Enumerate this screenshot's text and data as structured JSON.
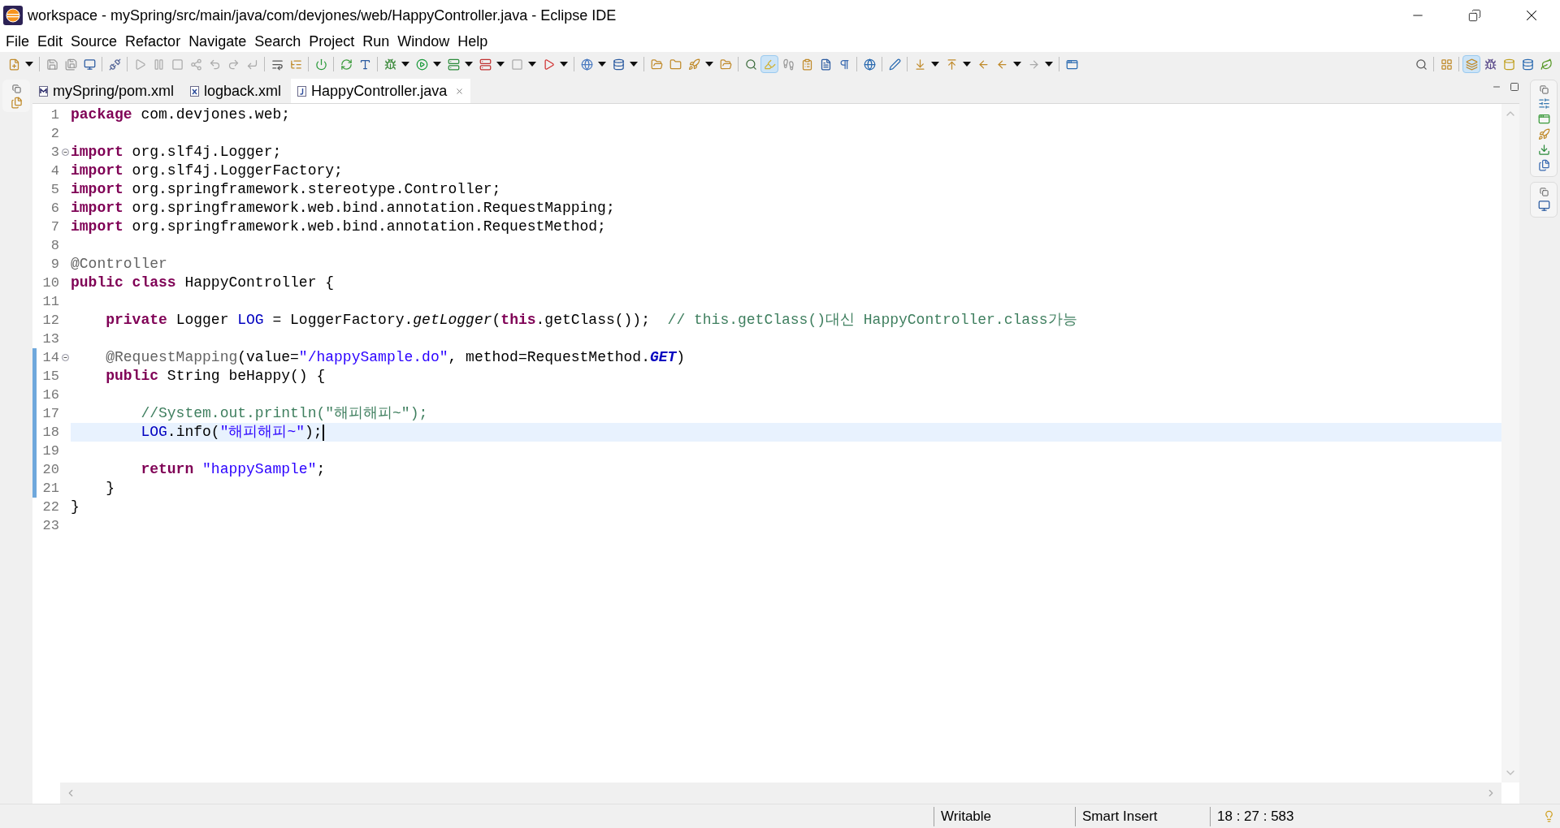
{
  "window": {
    "title": "workspace - mySpring/src/main/java/com/devjones/web/HappyController.java - Eclipse IDE"
  },
  "menu": [
    "File",
    "Edit",
    "Source",
    "Refactor",
    "Navigate",
    "Search",
    "Project",
    "Run",
    "Window",
    "Help"
  ],
  "tabs": [
    {
      "label": "mySpring/pom.xml",
      "kind": "maven",
      "selected": false
    },
    {
      "label": "logback.xml",
      "kind": "xml",
      "selected": false
    },
    {
      "label": "HappyController.java",
      "kind": "java",
      "selected": true
    }
  ],
  "editor": {
    "lines": [
      {
        "number": "1",
        "tokens": [
          {
            "kind": "keyword",
            "text": "package"
          },
          {
            "kind": "plain",
            "text": " com.devjones.web;"
          }
        ]
      },
      {
        "number": "2"
      },
      {
        "number": "3",
        "foldable": true,
        "tokens": [
          {
            "kind": "keyword",
            "text": "import"
          },
          {
            "kind": "plain",
            "text": " org.slf4j.Logger;"
          }
        ]
      },
      {
        "number": "4",
        "tokens": [
          {
            "kind": "keyword",
            "text": "import"
          },
          {
            "kind": "plain",
            "text": " org.slf4j.LoggerFactory;"
          }
        ]
      },
      {
        "number": "5",
        "tokens": [
          {
            "kind": "keyword",
            "text": "import"
          },
          {
            "kind": "plain",
            "text": " org.springframework.stereotype.Controller;"
          }
        ]
      },
      {
        "number": "6",
        "tokens": [
          {
            "kind": "keyword",
            "text": "import"
          },
          {
            "kind": "plain",
            "text": " org.springframework.web.bind.annotation.RequestMapping;"
          }
        ]
      },
      {
        "number": "7",
        "tokens": [
          {
            "kind": "keyword",
            "text": "import"
          },
          {
            "kind": "plain",
            "text": " org.springframework.web.bind.annotation.RequestMethod;"
          }
        ]
      },
      {
        "number": "8"
      },
      {
        "number": "9",
        "tokens": [
          {
            "kind": "annotation",
            "text": "@Controller"
          }
        ]
      },
      {
        "number": "10",
        "tokens": [
          {
            "kind": "keyword",
            "text": "public"
          },
          {
            "kind": "keyword",
            "text": " class"
          },
          {
            "kind": "plain",
            "text": " HappyController {"
          }
        ]
      },
      {
        "number": "11"
      },
      {
        "number": "12",
        "tokens": [
          {
            "kind": "keyword",
            "text": "    private"
          },
          {
            "kind": "plain",
            "text": " Logger "
          },
          {
            "kind": "field",
            "text": "LOG"
          },
          {
            "kind": "plain",
            "text": " = LoggerFactory."
          },
          {
            "kind": "static",
            "text": "getLogger"
          },
          {
            "kind": "plain",
            "text": "("
          },
          {
            "kind": "keyword",
            "text": "this"
          },
          {
            "kind": "plain",
            "text": ".getClass());  "
          },
          {
            "kind": "comment",
            "text": "// this.getClass()대신 HappyController.class가능"
          }
        ]
      },
      {
        "number": "13"
      },
      {
        "number": "14",
        "foldable": true,
        "changed": true,
        "tokens": [
          {
            "kind": "annotation",
            "text": "    @RequestMapping"
          },
          {
            "kind": "plain",
            "text": "(value="
          },
          {
            "kind": "string",
            "text": "\"/happySample.do\""
          },
          {
            "kind": "plain",
            "text": ", method=RequestMethod."
          },
          {
            "kind": "staticfield",
            "text": "GET"
          },
          {
            "kind": "plain",
            "text": ")"
          }
        ]
      },
      {
        "number": "15",
        "changed": true,
        "tokens": [
          {
            "kind": "keyword",
            "text": "    public"
          },
          {
            "kind": "plain",
            "text": " String beHappy() {"
          }
        ]
      },
      {
        "number": "16",
        "changed": true
      },
      {
        "number": "17",
        "changed": true,
        "tokens": [
          {
            "kind": "comment",
            "text": "        //System.out.println(\"해피해피~\");"
          }
        ]
      },
      {
        "number": "18",
        "changed": true,
        "current": true,
        "tokens": [
          {
            "kind": "field",
            "text": "        LOG"
          },
          {
            "kind": "plain",
            "text": ".info("
          },
          {
            "kind": "string",
            "text": "\"해피해피~\""
          },
          {
            "kind": "plain",
            "text": ");"
          }
        ]
      },
      {
        "number": "19",
        "changed": true
      },
      {
        "number": "20",
        "changed": true,
        "tokens": [
          {
            "kind": "keyword",
            "text": "        return"
          },
          {
            "kind": "string",
            "text": " \"happySample\""
          },
          {
            "kind": "plain",
            "text": ";"
          }
        ]
      },
      {
        "number": "21",
        "changed": true,
        "tokens": [
          {
            "kind": "plain",
            "text": "    }"
          }
        ]
      },
      {
        "number": "22",
        "tokens": [
          {
            "kind": "plain",
            "text": "}"
          }
        ]
      },
      {
        "number": "23"
      }
    ]
  },
  "status_bar": {
    "mode": "Writable",
    "insert": "Smart Insert",
    "position": "18 : 27 : 583"
  }
}
